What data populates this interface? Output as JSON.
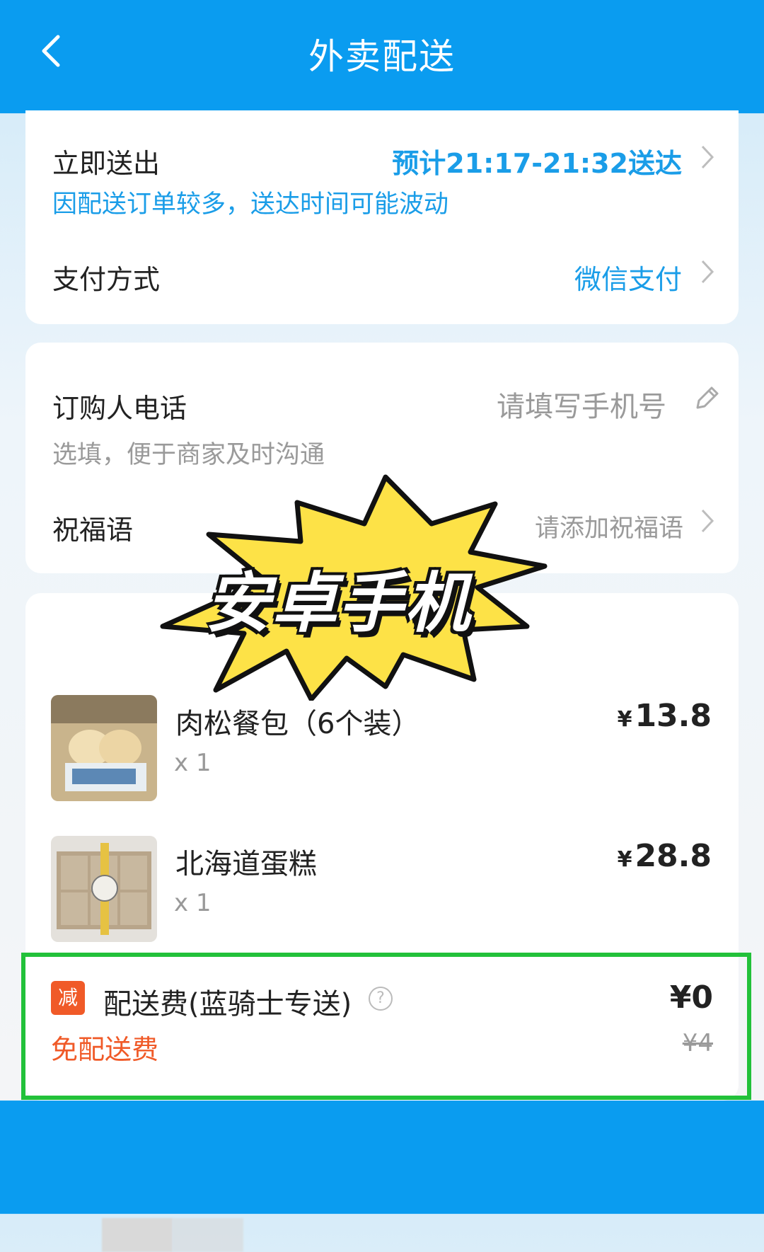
{
  "header": {
    "title": "外卖配送"
  },
  "delivery": {
    "label": "立即送出",
    "eta": "预计21:17-21:32送达",
    "notice": "因配送订单较多，送达时间可能波动"
  },
  "payment": {
    "label": "支付方式",
    "value": "微信支付"
  },
  "phone": {
    "label": "订购人电话",
    "placeholder": "请填写手机号",
    "hint": "选填，便于商家及时沟通"
  },
  "blessing": {
    "label": "祝福语",
    "placeholder": "请添加祝福语"
  },
  "watermark": {
    "text": "安卓手机"
  },
  "items": [
    {
      "name": "肉松餐包（6个装）",
      "qty": "x 1",
      "currency": "¥",
      "price": "13.8"
    },
    {
      "name": "北海道蛋糕",
      "qty": "x 1",
      "currency": "¥",
      "price": "28.8"
    }
  ],
  "delivery_fee": {
    "badge": "减",
    "label": "配送费(蓝骑士专送)",
    "price": "¥0",
    "original_price": "¥4",
    "promo": "免配送费"
  },
  "colors": {
    "header": "#0a9cf0",
    "accent_blue": "#1a9de8",
    "promo_red": "#f05a28",
    "highlight_green": "#22c13a"
  }
}
